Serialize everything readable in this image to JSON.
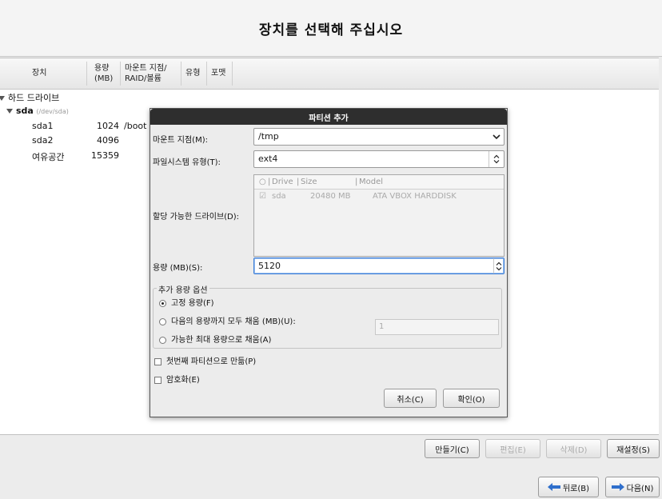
{
  "header": {
    "title": "장치를 선택해 주십시오"
  },
  "columns": [
    {
      "line1": "장치",
      "line2": ""
    },
    {
      "line1": "용량",
      "line2": "(MB)"
    },
    {
      "line1": "마운트 지점/",
      "line2": "RAID/볼륨"
    },
    {
      "line1": "유형",
      "line2": ""
    },
    {
      "line1": "포맷",
      "line2": ""
    }
  ],
  "tree": {
    "group": "하드 드라이브",
    "disk": {
      "name": "sda",
      "path": "(/dev/sda)"
    },
    "rows": [
      {
        "device": "sda1",
        "size": "1024",
        "mount": "/boot"
      },
      {
        "device": "sda2",
        "size": "4096",
        "mount": ""
      },
      {
        "device": "여유공간",
        "size": "15359",
        "mount": ""
      }
    ]
  },
  "dialog": {
    "title": "파티션 추가",
    "mount_label": "마운트 지점(M):",
    "mount_value": "/tmp",
    "fs_label": "파일시스템 유형(T):",
    "fs_value": "ext4",
    "drives_label": "할당 가능한 드라이브(D):",
    "drives_header": [
      "Drive",
      "Size",
      "Model"
    ],
    "drive_row": {
      "drive": "sda",
      "size": "20480 MB",
      "model": "ATA VBOX HARDDISK",
      "checked": true
    },
    "size_label": "용량 (MB)(S):",
    "size_value": "5120",
    "options_legend": "추가 용량 옵션",
    "opt_fixed": "고정 용량(F)",
    "opt_fill_upto": "다음의 용량까지 모두 채움 (MB)(U):",
    "opt_fill_upto_value": "1",
    "opt_fill_max": "가능한 최대 용량으로 채움(A)",
    "selected_option": "fixed",
    "primary_check": "첫번째 파티션으로 만듦(P)",
    "encrypt_check": "암호화(E)",
    "cancel_label": "취소(C)",
    "ok_label": "확인(O)"
  },
  "toolbar": {
    "create_label": "만들기(C)",
    "edit_label": "편집(E)",
    "delete_label": "삭제(D)",
    "reset_label": "재설정(S)"
  },
  "nav": {
    "back_label": "뒤로(B)",
    "next_label": "다음(N)"
  },
  "colors": {
    "accent": "#3b7dd8",
    "dialog_title_bg": "#2e2e2e",
    "arrow": "#2f6fcc"
  }
}
